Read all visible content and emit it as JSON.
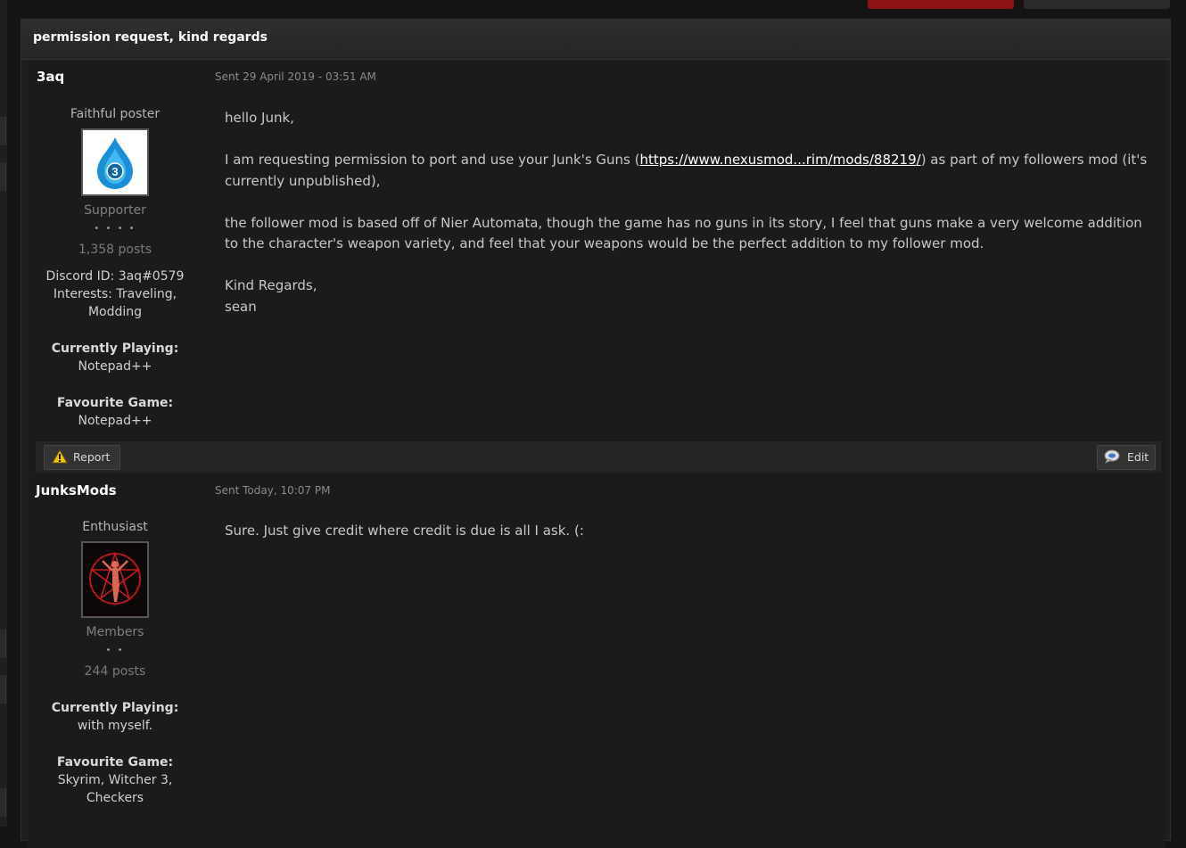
{
  "conversation": {
    "title": "permission request, kind regards"
  },
  "posts": [
    {
      "author": "3aq",
      "date": "Sent 29 April 2019 - 03:51 AM",
      "rank_title": "Faithful poster",
      "avatar_icon": "water-drop-avatar-icon",
      "group": "Supporter",
      "pips": "• • • •",
      "post_count": "1,358 posts",
      "extra_fields": [
        "Discord ID: 3aq#0579",
        "Interests: Traveling,",
        "Modding"
      ],
      "currently_playing_label": "Currently Playing:",
      "currently_playing": "Notepad++",
      "favourite_game_label": "Favourite Game:",
      "favourite_game": "Notepad++",
      "body": {
        "greeting": "hello Junk,",
        "p1_before": "I am requesting permission to port and use your Junk's Guns (",
        "p1_link": "https://www.nexusmod...rim/mods/88219/",
        "p1_after": ")  as part of my followers mod (it's currently unpublished),",
        "p2": "the follower mod is based off of Nier Automata, though the game has no guns in its story, I feel that guns make a very welcome addition to the character's weapon variety, and feel that your weapons would be the perfect addition to my follower mod.",
        "closing": "Kind Regards,",
        "signature": "sean"
      },
      "report_label": "Report",
      "edit_label": "Edit"
    },
    {
      "author": "JunksMods",
      "date": "Sent Today, 10:07 PM",
      "rank_title": "Enthusiast",
      "avatar_icon": "pentagram-figure-avatar-icon",
      "group": "Members",
      "pips": "• •",
      "post_count": "244 posts",
      "currently_playing_label": "Currently Playing:",
      "currently_playing": "with myself.",
      "favourite_game_label": "Favourite Game:",
      "favourite_game_lines": [
        "Skyrim, Witcher 3,",
        "Checkers"
      ],
      "body": {
        "p1": "Sure. Just give credit where credit is due is all I ask. (:"
      }
    }
  ],
  "colors": {
    "background": "#141414",
    "panel": "#1b1b1b",
    "accent_red": "#8c1414",
    "link": "#ffffff"
  }
}
